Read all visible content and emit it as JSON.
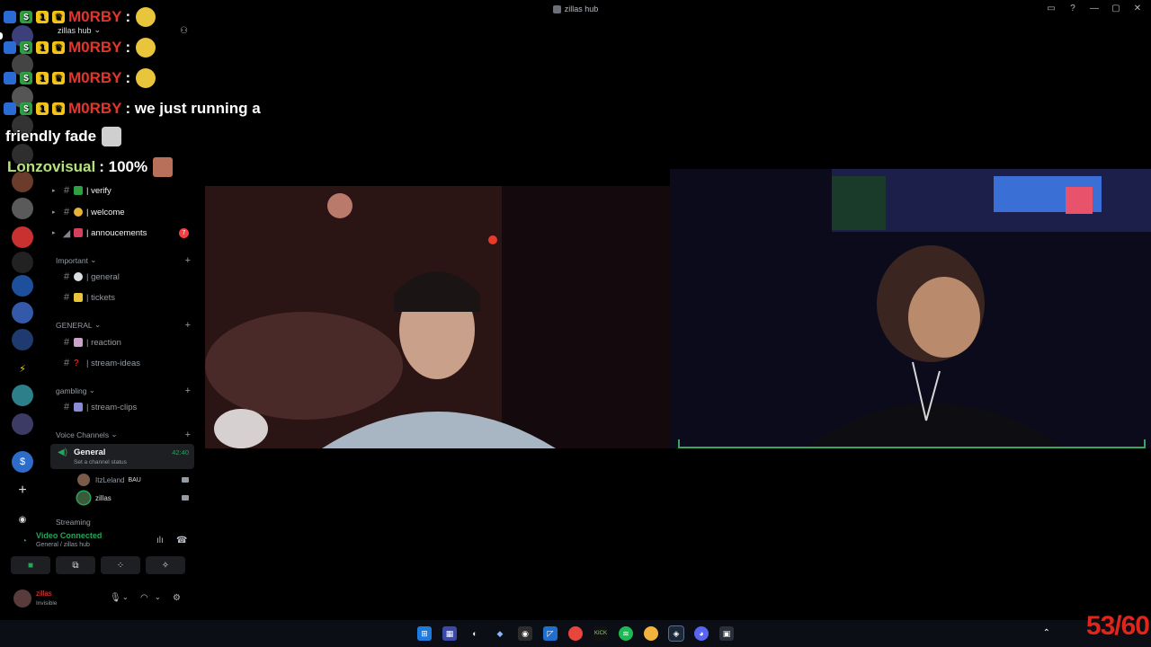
{
  "window": {
    "title": "zillas hub",
    "controls": [
      "▭",
      "?",
      "—",
      "▢",
      "✕"
    ]
  },
  "server": {
    "name": "zillas hub"
  },
  "channels": {
    "top": [
      {
        "name": "| verify"
      },
      {
        "name": "| welcome"
      },
      {
        "name": "| annoucements",
        "badge": "7"
      }
    ],
    "categories": [
      {
        "label": "Important",
        "channels": [
          "| general",
          "| tickets"
        ]
      },
      {
        "label": "GENERAL",
        "channels": [
          "| reaction",
          "| stream-ideas"
        ]
      },
      {
        "label": "gambling",
        "channels": [
          "| stream-clips"
        ]
      },
      {
        "label": "Voice Channels"
      }
    ],
    "voice": {
      "name": "General",
      "timer": "42:40",
      "status": "Set a channel status",
      "users": [
        {
          "name": "ItzLeland",
          "tag": "BAU"
        },
        {
          "name": "zillas"
        }
      ],
      "next": "Streaming"
    }
  },
  "rtc": {
    "status": "Video Connected",
    "location": "General / zillas hub"
  },
  "user": {
    "name": "zillas",
    "status": "Invisible"
  },
  "overlay_chat": [
    {
      "user": "M0RBY",
      "message": ":"
    },
    {
      "user": "M0RBY",
      "message": ":"
    },
    {
      "user": "M0RBY",
      "message": ":"
    },
    {
      "user": "M0RBY",
      "message": ": we just running a"
    },
    {
      "continuation": "friendly fade"
    },
    {
      "user": "Lonzovisual",
      "message": ": 100%"
    }
  ],
  "stream_counter": "53/60",
  "colors": {
    "accent_green": "#23a55a",
    "chat_name_red": "#e3352b",
    "chat_name_green": "#b6e27b",
    "badge_red": "#f23f43"
  },
  "taskbar": {
    "icons": [
      "windows-start-icon",
      "widgets-icon",
      "browser-icon",
      "app-icon",
      "obs-icon",
      "vscode-icon",
      "chrome-icon",
      "kick-icon",
      "spotify-icon",
      "chrome-icon",
      "steam-icon",
      "discord-icon",
      "app-icon"
    ]
  }
}
